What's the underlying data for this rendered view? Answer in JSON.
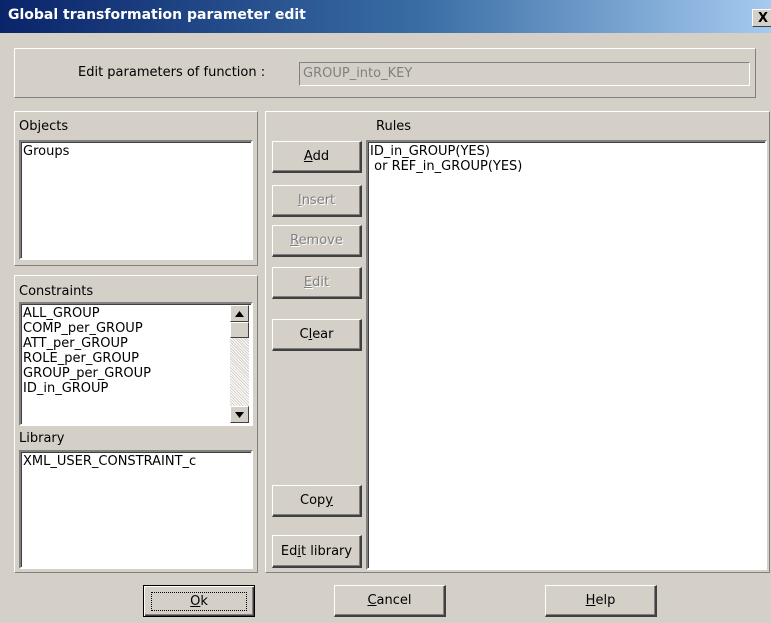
{
  "window": {
    "title": "Global transformation parameter edit",
    "close_glyph": "X"
  },
  "header": {
    "function_label": "Edit parameters of function :",
    "function_value": "GROUP_into_KEY"
  },
  "objects": {
    "label": "Objects",
    "items": [
      "Groups"
    ]
  },
  "constraints": {
    "label": "Constraints",
    "items": [
      "ALL_GROUP",
      "COMP_per_GROUP",
      "ATT_per_GROUP",
      "ROLE_per_GROUP",
      "GROUP_per_GROUP",
      "ID_in_GROUP"
    ]
  },
  "library": {
    "label": "Library",
    "items": [
      "XML_USER_CONSTRAINT_c"
    ]
  },
  "rules": {
    "label": "Rules",
    "lines": [
      "ID_in_GROUP(YES)",
      " or REF_in_GROUP(YES)"
    ]
  },
  "buttons": {
    "add": {
      "pre": "",
      "key": "A",
      "post": "dd"
    },
    "insert": {
      "pre": "",
      "key": "I",
      "post": "nsert"
    },
    "remove": {
      "pre": "",
      "key": "R",
      "post": "emove"
    },
    "edit": {
      "pre": "",
      "key": "E",
      "post": "dit"
    },
    "clear": {
      "pre": "C",
      "key": "l",
      "post": "ear"
    },
    "copy": {
      "pre": "Cop",
      "key": "y",
      "post": ""
    },
    "edit_library": {
      "pre": "Ed",
      "key": "i",
      "post": "t library"
    },
    "ok": {
      "pre": "",
      "key": "O",
      "post": "k"
    },
    "cancel": {
      "pre": "",
      "key": "C",
      "post": "ancel"
    },
    "help": {
      "pre": "",
      "key": "H",
      "post": "elp"
    }
  },
  "icons": {
    "scroll_up": "arrow-up-icon",
    "scroll_down": "arrow-down-icon"
  },
  "colors": {
    "titlebar_start": "#0a246a",
    "titlebar_end": "#a6caf0",
    "face": "#d4d0c8"
  }
}
